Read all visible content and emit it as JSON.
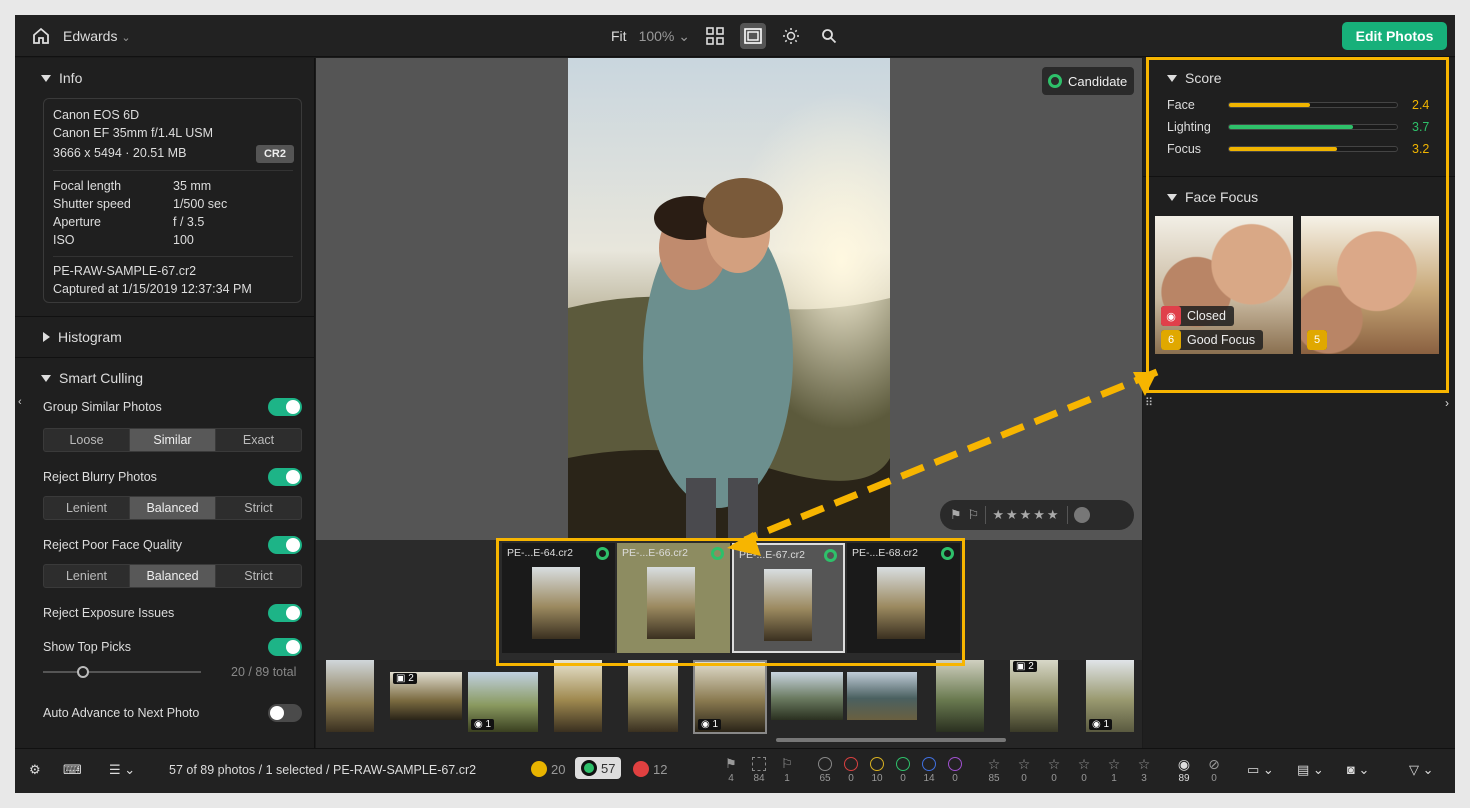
{
  "topbar": {
    "catalog": "Edwards",
    "fit": "Fit",
    "zoom": "100%",
    "edit_button": "Edit Photos"
  },
  "info": {
    "section_title": "Info",
    "camera": "Canon EOS 6D",
    "lens": "Canon EF 35mm f/1.4L USM",
    "dimensions": "3666 x 5494 · 20.51 MB",
    "format_badge": "CR2",
    "specs": [
      {
        "label": "Focal length",
        "value": "35 mm"
      },
      {
        "label": "Shutter speed",
        "value": "1/500 sec"
      },
      {
        "label": "Aperture",
        "value": "f / 3.5"
      },
      {
        "label": "ISO",
        "value": "100"
      }
    ],
    "filename": "PE-RAW-SAMPLE-67.cr2",
    "captured": "Captured at 1/15/2019 12:37:34 PM"
  },
  "histogram": {
    "section_title": "Histogram"
  },
  "smart_culling": {
    "section_title": "Smart Culling",
    "group_similar": {
      "label": "Group Similar Photos",
      "on": true,
      "options": [
        "Loose",
        "Similar",
        "Exact"
      ],
      "selected": "Similar"
    },
    "reject_blurry": {
      "label": "Reject Blurry Photos",
      "on": true,
      "options": [
        "Lenient",
        "Balanced",
        "Strict"
      ],
      "selected": "Balanced"
    },
    "reject_face": {
      "label": "Reject Poor Face Quality",
      "on": true,
      "options": [
        "Lenient",
        "Balanced",
        "Strict"
      ],
      "selected": "Balanced"
    },
    "reject_exposure": {
      "label": "Reject Exposure Issues",
      "on": true
    },
    "show_top_picks": {
      "label": "Show Top Picks",
      "on": true,
      "slider_value": 20,
      "slider_total_text": "/ 89 total"
    },
    "auto_advance": {
      "label": "Auto Advance to Next Photo",
      "on": false
    }
  },
  "viewer": {
    "candidate_label": "Candidate"
  },
  "similar_group": [
    {
      "name": "PE-...E-64.cr2",
      "selected": false
    },
    {
      "name": "PE-...E-66.cr2",
      "selected": false
    },
    {
      "name": "PE-...E-67.cr2",
      "selected": true
    },
    {
      "name": "PE-...E-68.cr2",
      "selected": false
    }
  ],
  "strip_badges": {
    "group_a": "2",
    "pick_a": "1",
    "current": "1",
    "group_b": "2",
    "pick_b": "1"
  },
  "score": {
    "section_title": "Score",
    "rows": [
      {
        "label": "Face",
        "value": "2.4",
        "color": "#f0b400",
        "fraction": 0.48
      },
      {
        "label": "Lighting",
        "value": "3.7",
        "color": "#2ec06a",
        "fraction": 0.74
      },
      {
        "label": "Focus",
        "value": "3.2",
        "color": "#f0b400",
        "fraction": 0.64
      }
    ]
  },
  "face_focus": {
    "section_title": "Face Focus",
    "faces": [
      {
        "eye_label": "Closed",
        "focus_score": "6",
        "focus_label": "Good Focus"
      },
      {
        "focus_score": "5"
      }
    ]
  },
  "bottom": {
    "status": "57 of 89 photos / 1 selected / PE-RAW-SAMPLE-67.cr2",
    "picks": "20",
    "candidates": "57",
    "rejects": "12",
    "flags": [
      "4",
      "84",
      "1"
    ],
    "colors": [
      "65",
      "0",
      "10",
      "0",
      "14",
      "0"
    ],
    "color_swatches": [
      "#888888",
      "#d84040",
      "#d8b020",
      "#2ec06a",
      "#4070e0",
      "#a050d0"
    ],
    "stars": [
      "85",
      "0",
      "0",
      "0",
      "1",
      "3"
    ],
    "visible": "89",
    "hidden": "0"
  }
}
